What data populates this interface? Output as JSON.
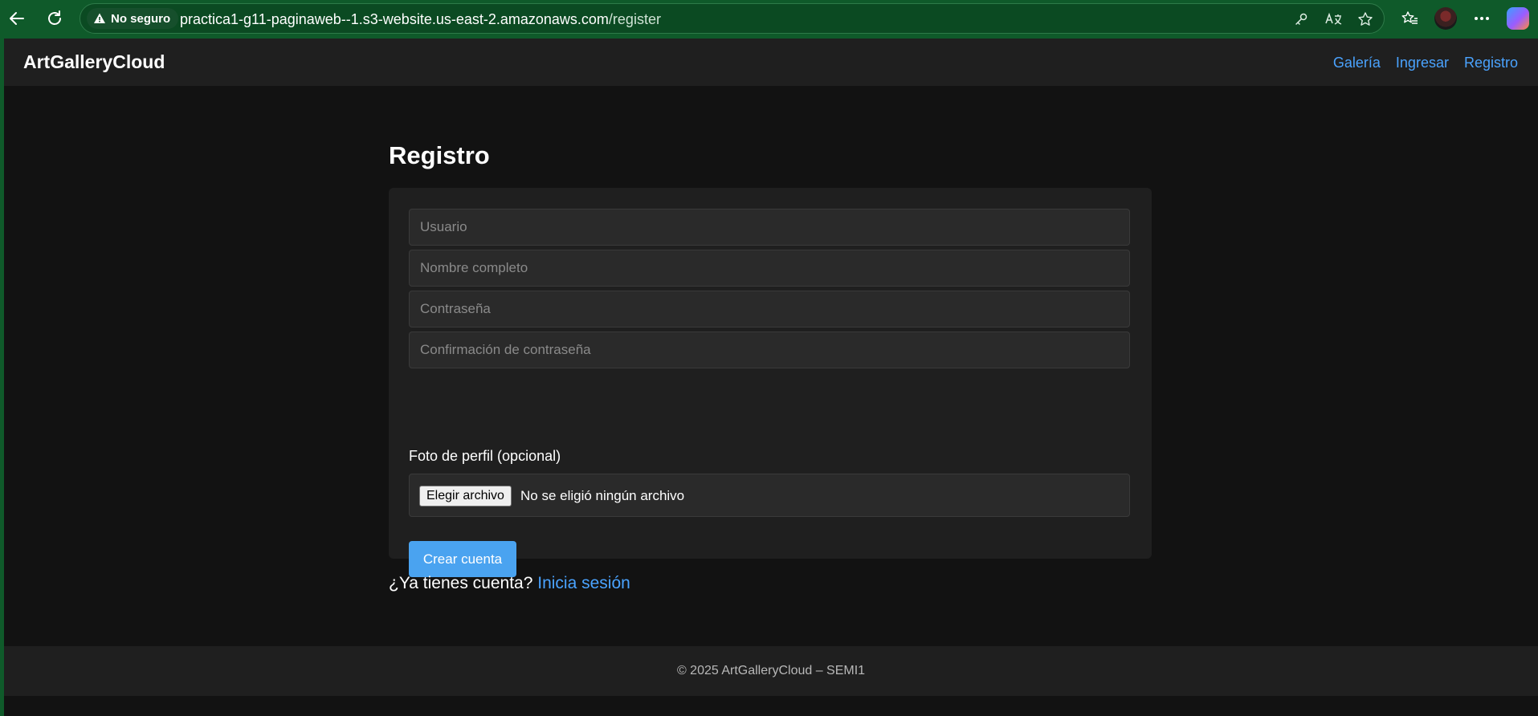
{
  "browser": {
    "security_label": "No seguro",
    "url_host": "practica1-g11-paginaweb--1.s3-website.us-east-2.amazonaws.com",
    "url_path": "/register"
  },
  "header": {
    "brand": "ArtGalleryCloud",
    "nav": [
      {
        "label": "Galería"
      },
      {
        "label": "Ingresar"
      },
      {
        "label": "Registro"
      }
    ]
  },
  "main": {
    "title": "Registro",
    "form": {
      "username_placeholder": "Usuario",
      "fullname_placeholder": "Nombre completo",
      "password_placeholder": "Contraseña",
      "confirm_placeholder": "Confirmación de contraseña",
      "photo_label": "Foto de perfil (opcional)",
      "file_button": "Elegir archivo",
      "file_status": "No se eligió ningún archivo",
      "submit_label": "Crear cuenta"
    },
    "login_prompt": "¿Ya tienes cuenta?",
    "login_link": "Inicia sesión"
  },
  "footer": {
    "text": "© 2025 ArtGalleryCloud – SEMI1"
  },
  "colors": {
    "accent": "#4aa3ff",
    "background": "#121212",
    "surface": "#1f1f1f",
    "chrome": "#0f5a2a"
  }
}
